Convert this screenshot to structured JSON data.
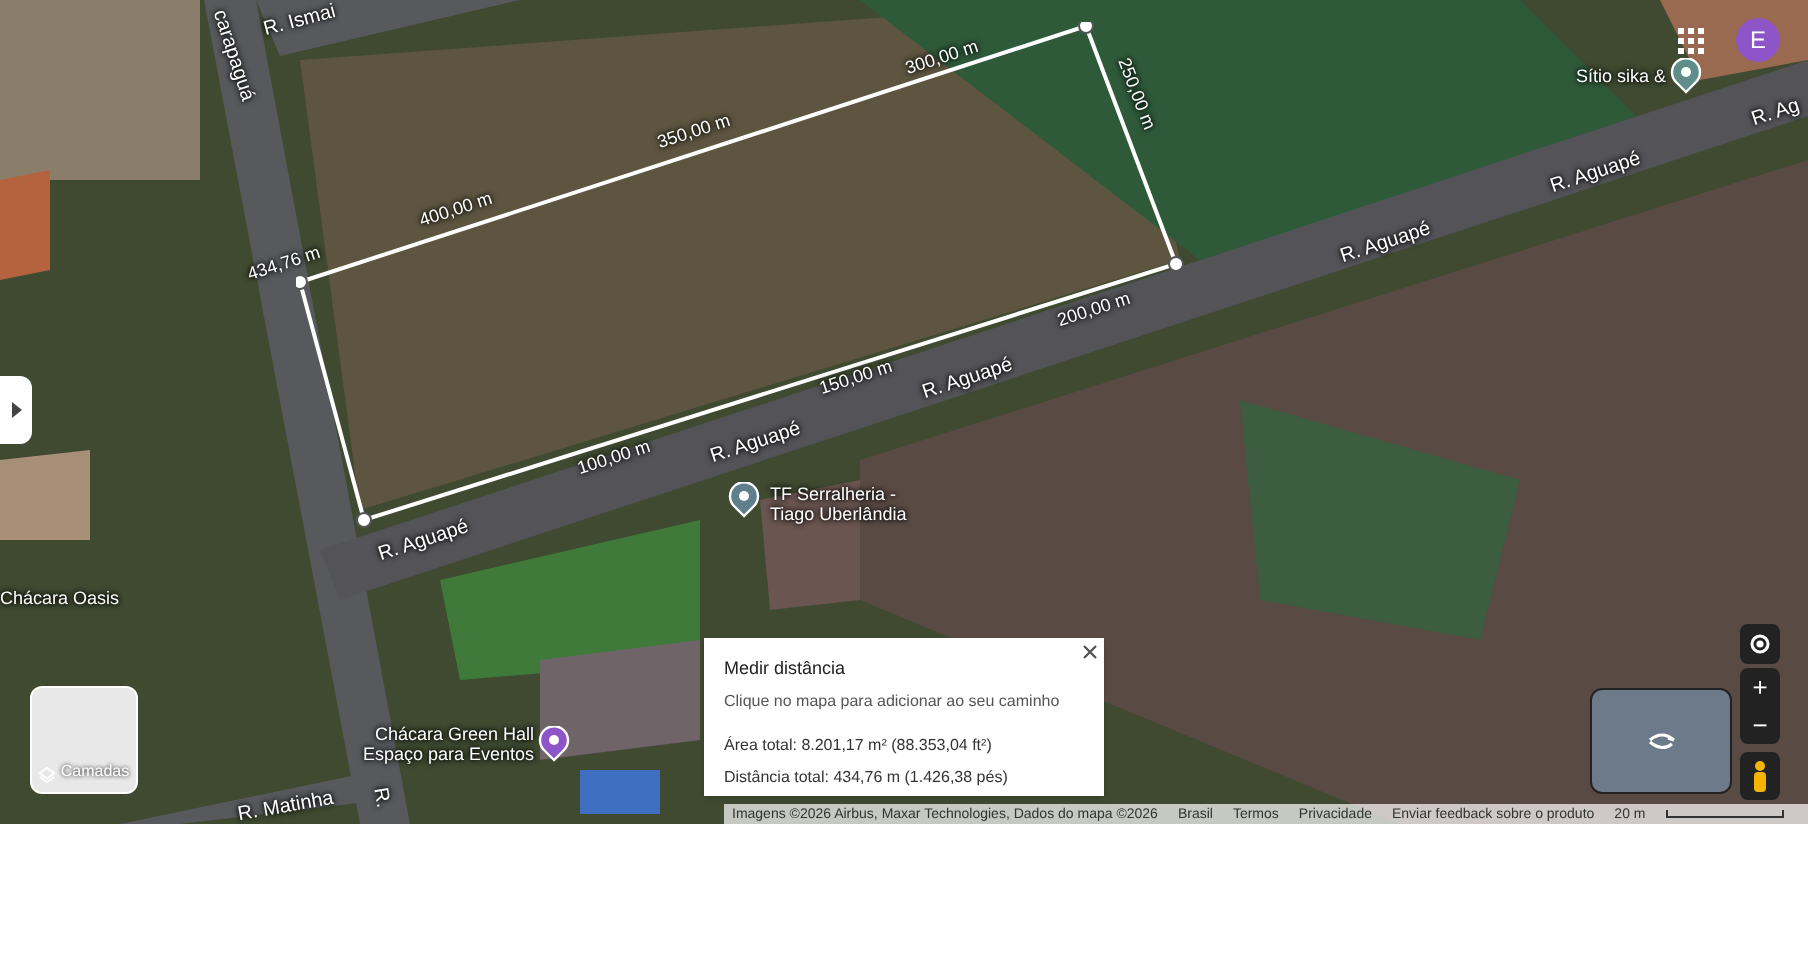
{
  "map": {
    "streets": [
      "R. Ismai",
      "carapaguá",
      "R. Aguapé",
      "R. Aguapé",
      "R. Aguapé",
      "R. Aguapé",
      "R. Aguapé",
      "R. Ag",
      "R. Matinha",
      "R."
    ],
    "places": [
      {
        "name": "TF Serralheria -\nTiago Uberlândia",
        "kind": "business"
      },
      {
        "name": "Chácara Oasis",
        "kind": "plain"
      },
      {
        "name": "Chácara Green Hall\nEspaço para Eventos",
        "kind": "event"
      },
      {
        "name": "Sítio sika &",
        "kind": "lodging"
      }
    ],
    "measurement": {
      "labels": [
        "434,76 m",
        "400,00 m",
        "350,00 m",
        "300,00 m",
        "250,00 m",
        "200,00 m",
        "150,00 m",
        "100,00 m"
      ]
    }
  },
  "account": {
    "avatar": "E"
  },
  "layers_button": {
    "label": "Camadas"
  },
  "measure_card": {
    "title": "Medir distância",
    "hint": "Clique no mapa para adicionar ao seu caminho",
    "area": "Área total: 8.201,17 m² (88.353,04 ft²)",
    "distance": "Distância total: 434,76 m (1.426,38 pés)"
  },
  "zoom_controls": {
    "in": "+",
    "out": "−"
  },
  "footer": {
    "attribution": "Imagens ©2026 Airbus, Maxar Technologies, Dados do mapa ©2026",
    "links": [
      "Brasil",
      "Termos",
      "Privacidade",
      "Enviar feedback sobre o produto"
    ],
    "scale": "20 m"
  }
}
